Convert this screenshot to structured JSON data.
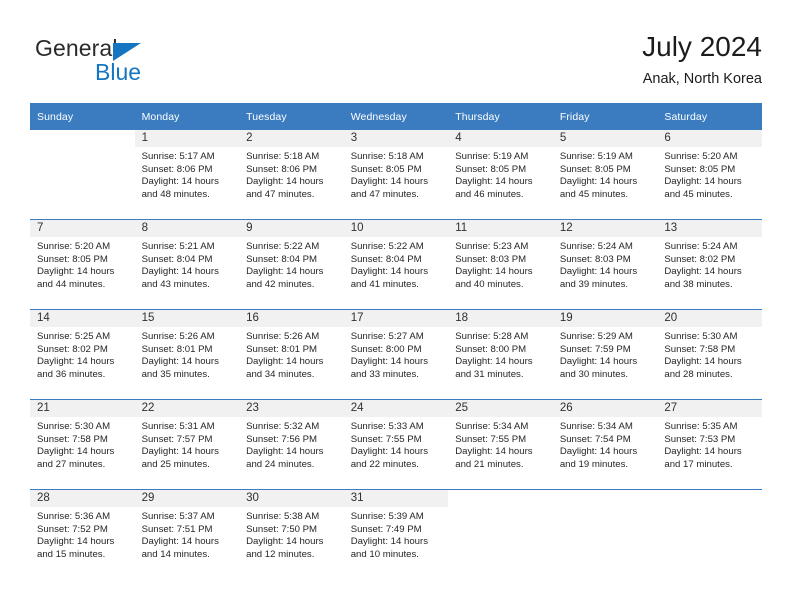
{
  "logo": {
    "primary_text": "General",
    "secondary_text": "Blue",
    "triangle_icon": "triangle-icon",
    "primary_color": "#2b2b2b",
    "accent_color": "#1575c0"
  },
  "header": {
    "month_title": "July 2024",
    "location": "Anak, North Korea"
  },
  "theme": {
    "header_bg": "#3b7cc0",
    "header_text": "#ffffff",
    "daynum_band_bg": "#f1f1f1",
    "row_divider": "#3b7cc0",
    "body_text": "#262626"
  },
  "weekday_headers": [
    "Sunday",
    "Monday",
    "Tuesday",
    "Wednesday",
    "Thursday",
    "Friday",
    "Saturday"
  ],
  "weeks": [
    [
      {
        "day": "",
        "sunrise": "",
        "sunset": "",
        "daylight_line1": "",
        "daylight_line2": "",
        "empty": true
      },
      {
        "day": "1",
        "sunrise": "Sunrise: 5:17 AM",
        "sunset": "Sunset: 8:06 PM",
        "daylight_line1": "Daylight: 14 hours",
        "daylight_line2": "and 48 minutes.",
        "empty": false
      },
      {
        "day": "2",
        "sunrise": "Sunrise: 5:18 AM",
        "sunset": "Sunset: 8:06 PM",
        "daylight_line1": "Daylight: 14 hours",
        "daylight_line2": "and 47 minutes.",
        "empty": false
      },
      {
        "day": "3",
        "sunrise": "Sunrise: 5:18 AM",
        "sunset": "Sunset: 8:05 PM",
        "daylight_line1": "Daylight: 14 hours",
        "daylight_line2": "and 47 minutes.",
        "empty": false
      },
      {
        "day": "4",
        "sunrise": "Sunrise: 5:19 AM",
        "sunset": "Sunset: 8:05 PM",
        "daylight_line1": "Daylight: 14 hours",
        "daylight_line2": "and 46 minutes.",
        "empty": false
      },
      {
        "day": "5",
        "sunrise": "Sunrise: 5:19 AM",
        "sunset": "Sunset: 8:05 PM",
        "daylight_line1": "Daylight: 14 hours",
        "daylight_line2": "and 45 minutes.",
        "empty": false
      },
      {
        "day": "6",
        "sunrise": "Sunrise: 5:20 AM",
        "sunset": "Sunset: 8:05 PM",
        "daylight_line1": "Daylight: 14 hours",
        "daylight_line2": "and 45 minutes.",
        "empty": false
      }
    ],
    [
      {
        "day": "7",
        "sunrise": "Sunrise: 5:20 AM",
        "sunset": "Sunset: 8:05 PM",
        "daylight_line1": "Daylight: 14 hours",
        "daylight_line2": "and 44 minutes.",
        "empty": false
      },
      {
        "day": "8",
        "sunrise": "Sunrise: 5:21 AM",
        "sunset": "Sunset: 8:04 PM",
        "daylight_line1": "Daylight: 14 hours",
        "daylight_line2": "and 43 minutes.",
        "empty": false
      },
      {
        "day": "9",
        "sunrise": "Sunrise: 5:22 AM",
        "sunset": "Sunset: 8:04 PM",
        "daylight_line1": "Daylight: 14 hours",
        "daylight_line2": "and 42 minutes.",
        "empty": false
      },
      {
        "day": "10",
        "sunrise": "Sunrise: 5:22 AM",
        "sunset": "Sunset: 8:04 PM",
        "daylight_line1": "Daylight: 14 hours",
        "daylight_line2": "and 41 minutes.",
        "empty": false
      },
      {
        "day": "11",
        "sunrise": "Sunrise: 5:23 AM",
        "sunset": "Sunset: 8:03 PM",
        "daylight_line1": "Daylight: 14 hours",
        "daylight_line2": "and 40 minutes.",
        "empty": false
      },
      {
        "day": "12",
        "sunrise": "Sunrise: 5:24 AM",
        "sunset": "Sunset: 8:03 PM",
        "daylight_line1": "Daylight: 14 hours",
        "daylight_line2": "and 39 minutes.",
        "empty": false
      },
      {
        "day": "13",
        "sunrise": "Sunrise: 5:24 AM",
        "sunset": "Sunset: 8:02 PM",
        "daylight_line1": "Daylight: 14 hours",
        "daylight_line2": "and 38 minutes.",
        "empty": false
      }
    ],
    [
      {
        "day": "14",
        "sunrise": "Sunrise: 5:25 AM",
        "sunset": "Sunset: 8:02 PM",
        "daylight_line1": "Daylight: 14 hours",
        "daylight_line2": "and 36 minutes.",
        "empty": false
      },
      {
        "day": "15",
        "sunrise": "Sunrise: 5:26 AM",
        "sunset": "Sunset: 8:01 PM",
        "daylight_line1": "Daylight: 14 hours",
        "daylight_line2": "and 35 minutes.",
        "empty": false
      },
      {
        "day": "16",
        "sunrise": "Sunrise: 5:26 AM",
        "sunset": "Sunset: 8:01 PM",
        "daylight_line1": "Daylight: 14 hours",
        "daylight_line2": "and 34 minutes.",
        "empty": false
      },
      {
        "day": "17",
        "sunrise": "Sunrise: 5:27 AM",
        "sunset": "Sunset: 8:00 PM",
        "daylight_line1": "Daylight: 14 hours",
        "daylight_line2": "and 33 minutes.",
        "empty": false
      },
      {
        "day": "18",
        "sunrise": "Sunrise: 5:28 AM",
        "sunset": "Sunset: 8:00 PM",
        "daylight_line1": "Daylight: 14 hours",
        "daylight_line2": "and 31 minutes.",
        "empty": false
      },
      {
        "day": "19",
        "sunrise": "Sunrise: 5:29 AM",
        "sunset": "Sunset: 7:59 PM",
        "daylight_line1": "Daylight: 14 hours",
        "daylight_line2": "and 30 minutes.",
        "empty": false
      },
      {
        "day": "20",
        "sunrise": "Sunrise: 5:30 AM",
        "sunset": "Sunset: 7:58 PM",
        "daylight_line1": "Daylight: 14 hours",
        "daylight_line2": "and 28 minutes.",
        "empty": false
      }
    ],
    [
      {
        "day": "21",
        "sunrise": "Sunrise: 5:30 AM",
        "sunset": "Sunset: 7:58 PM",
        "daylight_line1": "Daylight: 14 hours",
        "daylight_line2": "and 27 minutes.",
        "empty": false
      },
      {
        "day": "22",
        "sunrise": "Sunrise: 5:31 AM",
        "sunset": "Sunset: 7:57 PM",
        "daylight_line1": "Daylight: 14 hours",
        "daylight_line2": "and 25 minutes.",
        "empty": false
      },
      {
        "day": "23",
        "sunrise": "Sunrise: 5:32 AM",
        "sunset": "Sunset: 7:56 PM",
        "daylight_line1": "Daylight: 14 hours",
        "daylight_line2": "and 24 minutes.",
        "empty": false
      },
      {
        "day": "24",
        "sunrise": "Sunrise: 5:33 AM",
        "sunset": "Sunset: 7:55 PM",
        "daylight_line1": "Daylight: 14 hours",
        "daylight_line2": "and 22 minutes.",
        "empty": false
      },
      {
        "day": "25",
        "sunrise": "Sunrise: 5:34 AM",
        "sunset": "Sunset: 7:55 PM",
        "daylight_line1": "Daylight: 14 hours",
        "daylight_line2": "and 21 minutes.",
        "empty": false
      },
      {
        "day": "26",
        "sunrise": "Sunrise: 5:34 AM",
        "sunset": "Sunset: 7:54 PM",
        "daylight_line1": "Daylight: 14 hours",
        "daylight_line2": "and 19 minutes.",
        "empty": false
      },
      {
        "day": "27",
        "sunrise": "Sunrise: 5:35 AM",
        "sunset": "Sunset: 7:53 PM",
        "daylight_line1": "Daylight: 14 hours",
        "daylight_line2": "and 17 minutes.",
        "empty": false
      }
    ],
    [
      {
        "day": "28",
        "sunrise": "Sunrise: 5:36 AM",
        "sunset": "Sunset: 7:52 PM",
        "daylight_line1": "Daylight: 14 hours",
        "daylight_line2": "and 15 minutes.",
        "empty": false
      },
      {
        "day": "29",
        "sunrise": "Sunrise: 5:37 AM",
        "sunset": "Sunset: 7:51 PM",
        "daylight_line1": "Daylight: 14 hours",
        "daylight_line2": "and 14 minutes.",
        "empty": false
      },
      {
        "day": "30",
        "sunrise": "Sunrise: 5:38 AM",
        "sunset": "Sunset: 7:50 PM",
        "daylight_line1": "Daylight: 14 hours",
        "daylight_line2": "and 12 minutes.",
        "empty": false
      },
      {
        "day": "31",
        "sunrise": "Sunrise: 5:39 AM",
        "sunset": "Sunset: 7:49 PM",
        "daylight_line1": "Daylight: 14 hours",
        "daylight_line2": "and 10 minutes.",
        "empty": false
      },
      {
        "day": "",
        "sunrise": "",
        "sunset": "",
        "daylight_line1": "",
        "daylight_line2": "",
        "empty": true
      },
      {
        "day": "",
        "sunrise": "",
        "sunset": "",
        "daylight_line1": "",
        "daylight_line2": "",
        "empty": true
      },
      {
        "day": "",
        "sunrise": "",
        "sunset": "",
        "daylight_line1": "",
        "daylight_line2": "",
        "empty": true
      }
    ]
  ]
}
